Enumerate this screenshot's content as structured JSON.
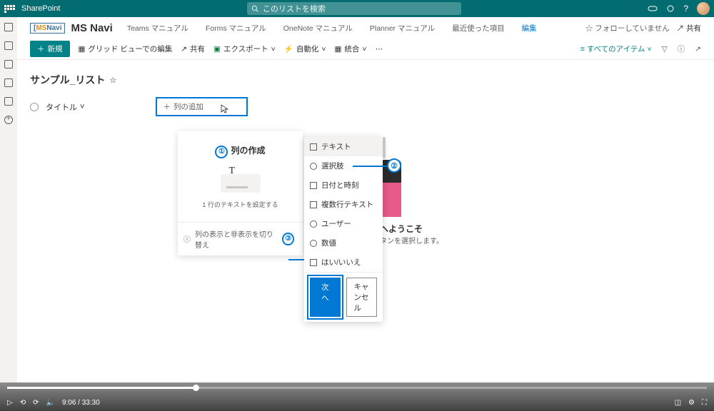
{
  "suite": {
    "app": "SharePoint",
    "search_placeholder": "このリストを検索"
  },
  "site": {
    "logo_a": "MS",
    "logo_b": "Navi",
    "title": "MS Navi",
    "nav": [
      "Teams マニュアル",
      "Forms マニュアル",
      "OneNote マニュアル",
      "Planner マニュアル",
      "最近使った項目"
    ],
    "nav_edit": "編集",
    "follow": "☆ フォローしていません",
    "share": "共有"
  },
  "cmd": {
    "new": "新規",
    "grid": "グリッド ビューでの編集",
    "share": "共有",
    "export": "エクスポート",
    "automate": "自動化",
    "integrate": "統合",
    "view": "すべてのアイテム"
  },
  "list": {
    "title": "サンプル_リスト",
    "col_title": "タイトル",
    "add_col": "列の追加"
  },
  "panel": {
    "title": "列の作成",
    "desc": "1 行のテキストを設定する",
    "toggle": "列の表示と非表示を切り替え"
  },
  "dd": {
    "items": [
      "テキスト",
      "選択肢",
      "日付と時刻",
      "複数行テキスト",
      "ユーザー",
      "数値",
      "はい/いいえ"
    ],
    "next": "次へ",
    "cancel": "キャンセル"
  },
  "welcome": {
    "title": "へようこそ",
    "sub": "タンを選択します。"
  },
  "anno": {
    "n1": "①",
    "n2": "②",
    "n3": "③"
  },
  "video": {
    "time": "9:06 / 33:30"
  }
}
